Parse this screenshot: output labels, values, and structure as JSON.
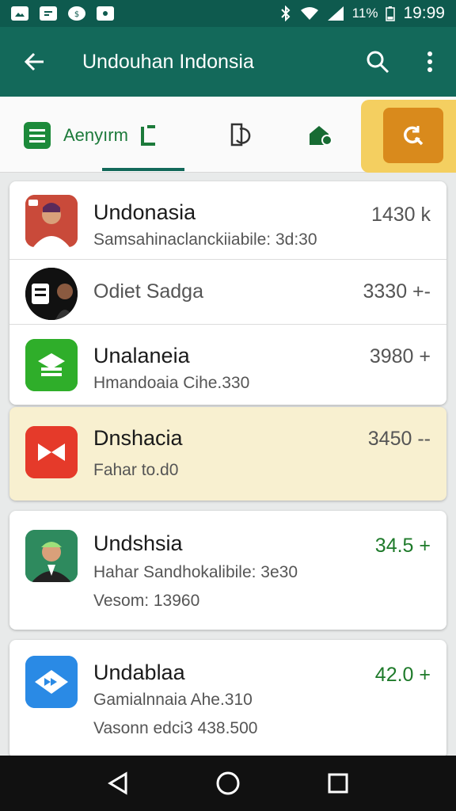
{
  "status_bar": {
    "battery_text": "11%",
    "time": "19:99"
  },
  "app_bar": {
    "title": "Undouhan Indonsia",
    "back_icon": "arrow-left-icon",
    "search_icon": "search-icon",
    "menu_icon": "more-vert-icon"
  },
  "tabs": {
    "main_label": "Aenyırm",
    "active_color": "#13695a",
    "highlight_color": "#f4cf60"
  },
  "items": [
    {
      "title": "Undonasia",
      "subtitle": "Samsahinaclanckiiabile: 3d:30",
      "value": "1430 k"
    },
    {
      "title": "Odiet Sadga",
      "subtitle": "",
      "value": "3330 +-"
    },
    {
      "title": "Unalaneia",
      "subtitle": "Hmandoaia Cihe.330",
      "value": "3980 +"
    },
    {
      "title": "Dnshacia",
      "subtitle": "Fahar to.d0",
      "value": "3450 --"
    },
    {
      "title": "Undshsia",
      "subtitle": "Hahar Sandhokalibile: 3e30",
      "extra": "Vesom: 13960",
      "value": "34.5 +"
    },
    {
      "title": "Undablaa",
      "subtitle": "Gamialnnaia Ahe.310",
      "extra": "Vasonn edci3 438.500",
      "value": "42.0 +"
    }
  ],
  "nav": {
    "back_icon": "triangle-back-icon",
    "home_icon": "circle-home-icon",
    "recents_icon": "square-recents-icon"
  }
}
